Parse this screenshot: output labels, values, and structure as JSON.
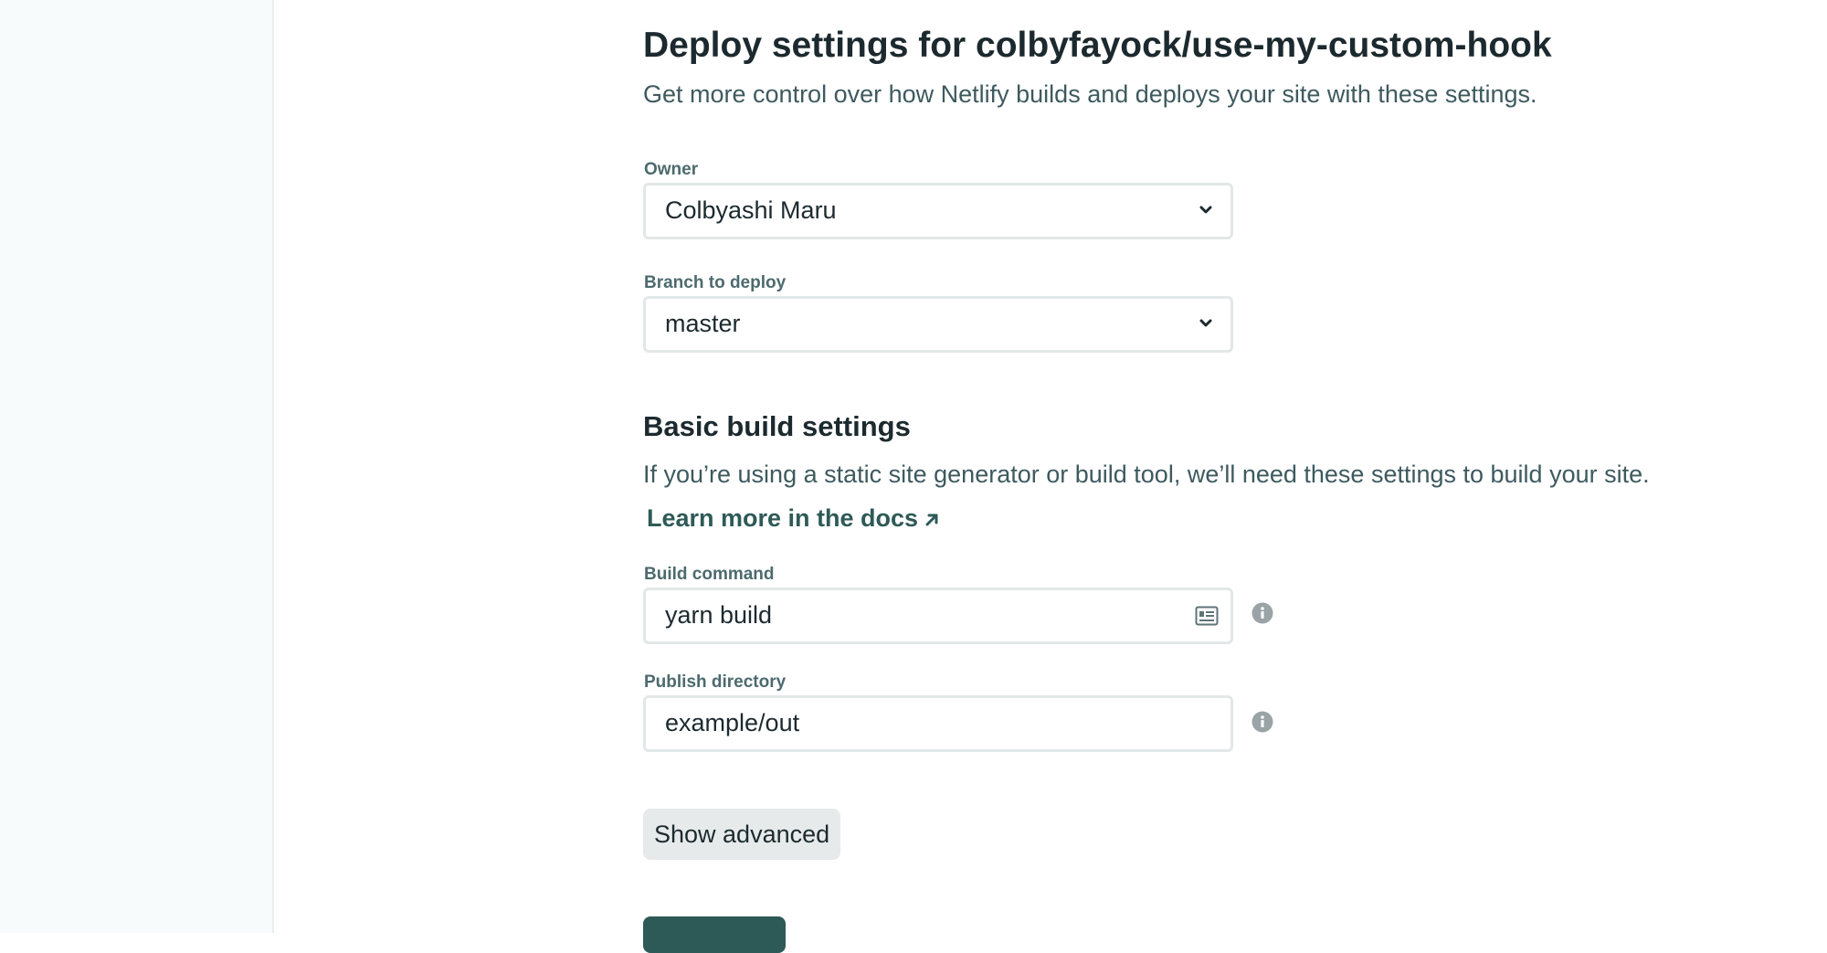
{
  "page": {
    "title": "Deploy settings for colbyfayock/use-my-custom-hook",
    "subtitle": "Get more control over how Netlify builds and deploys your site with these settings."
  },
  "owner": {
    "label": "Owner",
    "selected": "Colbyashi Maru"
  },
  "branch": {
    "label": "Branch to deploy",
    "selected": "master"
  },
  "basic_build": {
    "title": "Basic build settings",
    "description": "If you’re using a static site generator or build tool, we’ll need these settings to build your site.",
    "docs_link": "Learn more in the docs"
  },
  "build_command": {
    "label": "Build command",
    "value": "yarn build",
    "icon": "document-icon"
  },
  "publish_directory": {
    "label": "Publish directory",
    "value": "example/out"
  },
  "buttons": {
    "show_advanced": "Show advanced"
  },
  "colors": {
    "text": "#1c2a2f",
    "muted": "#3e5a5f",
    "label": "#4d6a6e",
    "accent": "#2d5956",
    "sidebar": "#f7fbfb"
  }
}
